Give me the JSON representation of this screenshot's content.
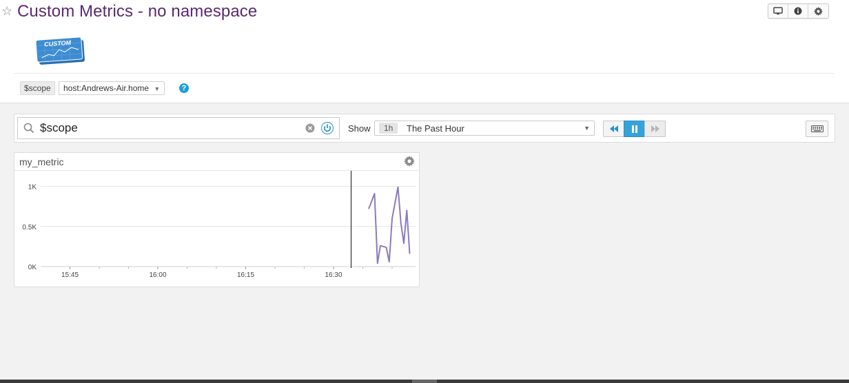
{
  "header": {
    "title": "Custom Metrics - no namespace",
    "logo_text": "CUSTOM",
    "buttons": [
      "monitor-icon",
      "info-icon",
      "gear-icon"
    ]
  },
  "scope": {
    "tag": "$scope",
    "value": "host:Andrews-Air.home",
    "help": "?"
  },
  "toolbar": {
    "search_value": "$scope",
    "show_label": "Show",
    "time_badge": "1h",
    "time_text": "The Past Hour"
  },
  "colors": {
    "title": "#5b2a6e",
    "accent": "#35a3db",
    "series": "#8c79bd"
  },
  "chart_data": {
    "type": "line",
    "title": "my_metric",
    "y_ticks": [
      "1K",
      "0.5K",
      "0K"
    ],
    "x_ticks": [
      "15:45",
      "16:00",
      "16:15",
      "16:30"
    ],
    "ylim": [
      0,
      1000
    ],
    "marker_time": "16:33",
    "series": [
      {
        "x": [
          "16:36",
          "16:37",
          "16:37:30",
          "16:38",
          "16:39",
          "16:39:30",
          "16:40",
          "16:41",
          "16:41:30",
          "16:42",
          "16:42:30",
          "16:43"
        ],
        "values": [
          720,
          910,
          40,
          260,
          240,
          60,
          600,
          990,
          540,
          290,
          700,
          160
        ]
      }
    ]
  }
}
